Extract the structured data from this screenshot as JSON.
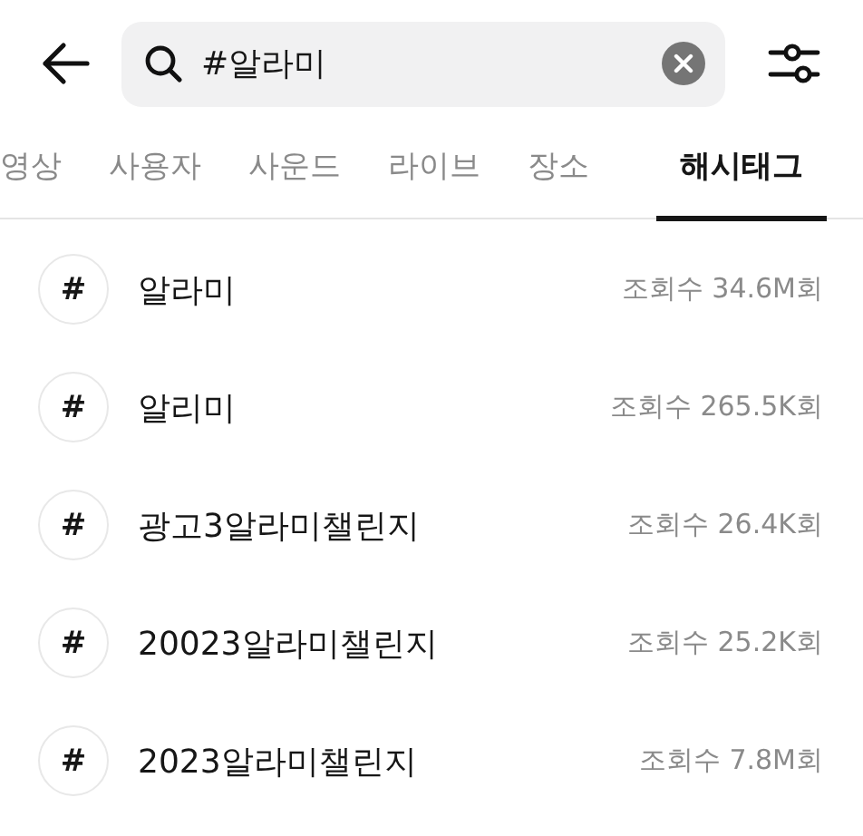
{
  "search": {
    "value": "#알라미"
  },
  "tabs": [
    {
      "label": "영상",
      "selected": false
    },
    {
      "label": "사용자",
      "selected": false
    },
    {
      "label": "사운드",
      "selected": false
    },
    {
      "label": "라이브",
      "selected": false
    },
    {
      "label": "장소",
      "selected": false
    },
    {
      "label": "해시태그",
      "selected": true
    }
  ],
  "hashtags": [
    {
      "symbol": "#",
      "name": "알라미",
      "views": "조회수 34.6M회"
    },
    {
      "symbol": "#",
      "name": "알리미",
      "views": "조회수 265.5K회"
    },
    {
      "symbol": "#",
      "name": "광고3알라미챌린지",
      "views": "조회수 26.4K회"
    },
    {
      "symbol": "#",
      "name": "20023알라미챌린지",
      "views": "조회수 25.2K회"
    },
    {
      "symbol": "#",
      "name": "2023알라미챌린지",
      "views": "조회수 7.8M회"
    }
  ]
}
